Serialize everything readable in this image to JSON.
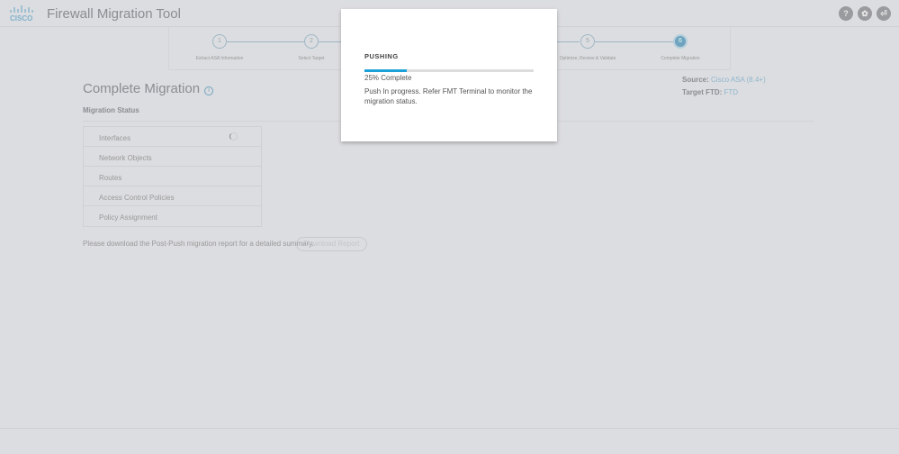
{
  "header": {
    "logo": "cisco",
    "title": "Firewall Migration Tool",
    "icons": [
      "help-icon",
      "gear-icon",
      "logout-icon"
    ]
  },
  "stepper": {
    "steps": [
      {
        "num": "1",
        "label": "Extract ASA Information"
      },
      {
        "num": "2",
        "label": "Select Target"
      },
      {
        "num": "5",
        "label": "Optimize, Review & Validate"
      },
      {
        "num": "6",
        "label": "Complete Migration",
        "active": true
      }
    ]
  },
  "main": {
    "title": "Complete Migration",
    "section": "Migration Status",
    "source_label": "Source:",
    "source_value": "Cisco ASA (8.4+)",
    "target_label": "Target FTD:",
    "target_value": "FTD",
    "items": [
      "Interfaces",
      "Network Objects",
      "Routes",
      "Access Control Policies",
      "Policy Assignment"
    ],
    "download_text": "Please download the Post-Push migration report for a detailed summary.",
    "download_button": "Download Report"
  },
  "modal": {
    "title": "PUSHING",
    "progress_percent": 25,
    "progress_text": "25% Complete",
    "message": "Push In progress. Refer FMT Terminal to monitor the migration status.",
    "accent": "#1ba0d7"
  }
}
